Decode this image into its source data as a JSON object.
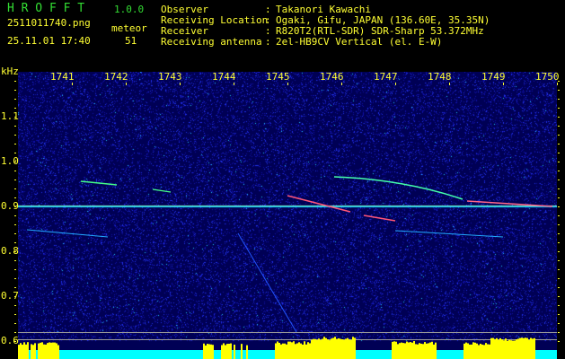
{
  "header": {
    "app_name": "H R O F F T",
    "version": "1.0.0",
    "filename": "2511011740.png",
    "datetime": "25.11.01 17:40",
    "meteor_label": "meteor",
    "meteor_count": "51",
    "fields": [
      {
        "label": "Observer",
        "value": "Takanori Kawachi"
      },
      {
        "label": "Receiving Location",
        "value": "Ogaki, Gifu, JAPAN (136.60E, 35.35N)"
      },
      {
        "label": "Receiver",
        "value": "R820T2(RTL-SDR) SDR-Sharp 53.372MHz"
      },
      {
        "label": "Receiving antenna",
        "value": "2el-HB9CV Vertical (el. E-W)"
      }
    ],
    "sep": ":"
  },
  "chart_data": {
    "type": "heatmap",
    "ylabel": "kHz",
    "x_ticks": [
      "1741",
      "1742",
      "1743",
      "1744",
      "1745",
      "1746",
      "1747",
      "1748",
      "1749",
      "1750"
    ],
    "xlim": [
      1740,
      1750
    ],
    "y_ticks": [
      "1.1",
      "1.0",
      "0.9",
      "0.8",
      "0.7",
      "0.6"
    ],
    "ylim": [
      0.57,
      1.2
    ],
    "carrier_khz": 0.9,
    "colors": {
      "background": "#000066",
      "noise": "#2233ff",
      "signal": "#00ffff",
      "strong": "#ff3355",
      "level_bar": "#ffff00",
      "level_base": "#00ffff"
    }
  }
}
